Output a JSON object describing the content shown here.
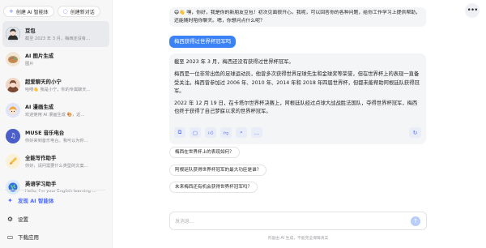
{
  "sidebar": {
    "new_agent_label": "创建 AI 智能体",
    "new_chat_label": "创建新对话",
    "agents": [
      {
        "name": "豆包",
        "desc": "截至 2023 年 3 月，梅西还没有…",
        "avatar_icon": "avatar-girl",
        "color": "#2c2c2c"
      },
      {
        "name": "AI 图片生成",
        "desc": "图片",
        "avatar_icon": "palette-icon",
        "color": "#8c6e52"
      },
      {
        "name": "超爱聊天的小宁",
        "desc": "哈喽👋 我是小宁，你的专属聊天…",
        "avatar_icon": "avatar-girl-2",
        "color": "#b98467"
      },
      {
        "name": "AI 漫画生成",
        "desc": "欢迎使用 AI 漫画生成 🎨，这…",
        "avatar_icon": "comic-icon",
        "color": "#8b93c9"
      },
      {
        "name": "MUSE 音乐电台",
        "desc": "你好来到音乐电台。我可以为你…",
        "avatar_icon": "music-icon",
        "color": "#4b5ec9"
      },
      {
        "name": "全能写作助手",
        "desc": "你好，请问需要什么类型的文案…",
        "avatar_icon": "pencil-icon",
        "color": "#f2c14e"
      },
      {
        "name": "英语学习助手",
        "desc": "Hello, I'm your English learning …",
        "avatar_icon": "globe-icon",
        "color": "#2d6fe0"
      }
    ],
    "discover_label": "发现 AI 智能体",
    "settings_label": "设置",
    "download_label": "下载应用"
  },
  "chat": {
    "intro": "😄👋 嘿，你好，我是你的新朋友豆包！初次见面很开心。我呢，可以回答你的各种问题，给你工作学习上提供帮助，还能随时陪你聊天。嗯，你想问点什么呢？",
    "user_message": "梅西获得过世界杯冠军吗",
    "answer": [
      "截至 2023 年 3 月，梅西还没有获得过世界杯冠军。",
      "梅西是一位非常出色的足球运动员，他曾多次获得世界足球先生和金球奖等荣誉，但在世界杯上的表现一直备受关注。梅西曾参加过 2006 年、2010 年、2014 年和 2018 年四届世界杯，但都未能帮助阿根廷队获得冠军。",
      "2022 年 12 月 19 日，在卡塔尔世界杯决赛上，阿根廷队经过点球大战战胜法国队，夺得世界杯冠军，梅西也终于获得了自己梦寐以求的世界杯冠军。"
    ],
    "suggestions": [
      "梅西在世界杯上的表现如何？",
      "阿根廷队获得世界杯冠军的最大功臣是谁？",
      "未来梅西还有机会获得世界杯冠军吗？"
    ],
    "input_placeholder": "发消息...",
    "disclaimer": "内容由 AI 生成，不能完全保障真实"
  },
  "colors": {
    "accent": "#4d6bfe",
    "user_bubble": "#3b82f6"
  }
}
